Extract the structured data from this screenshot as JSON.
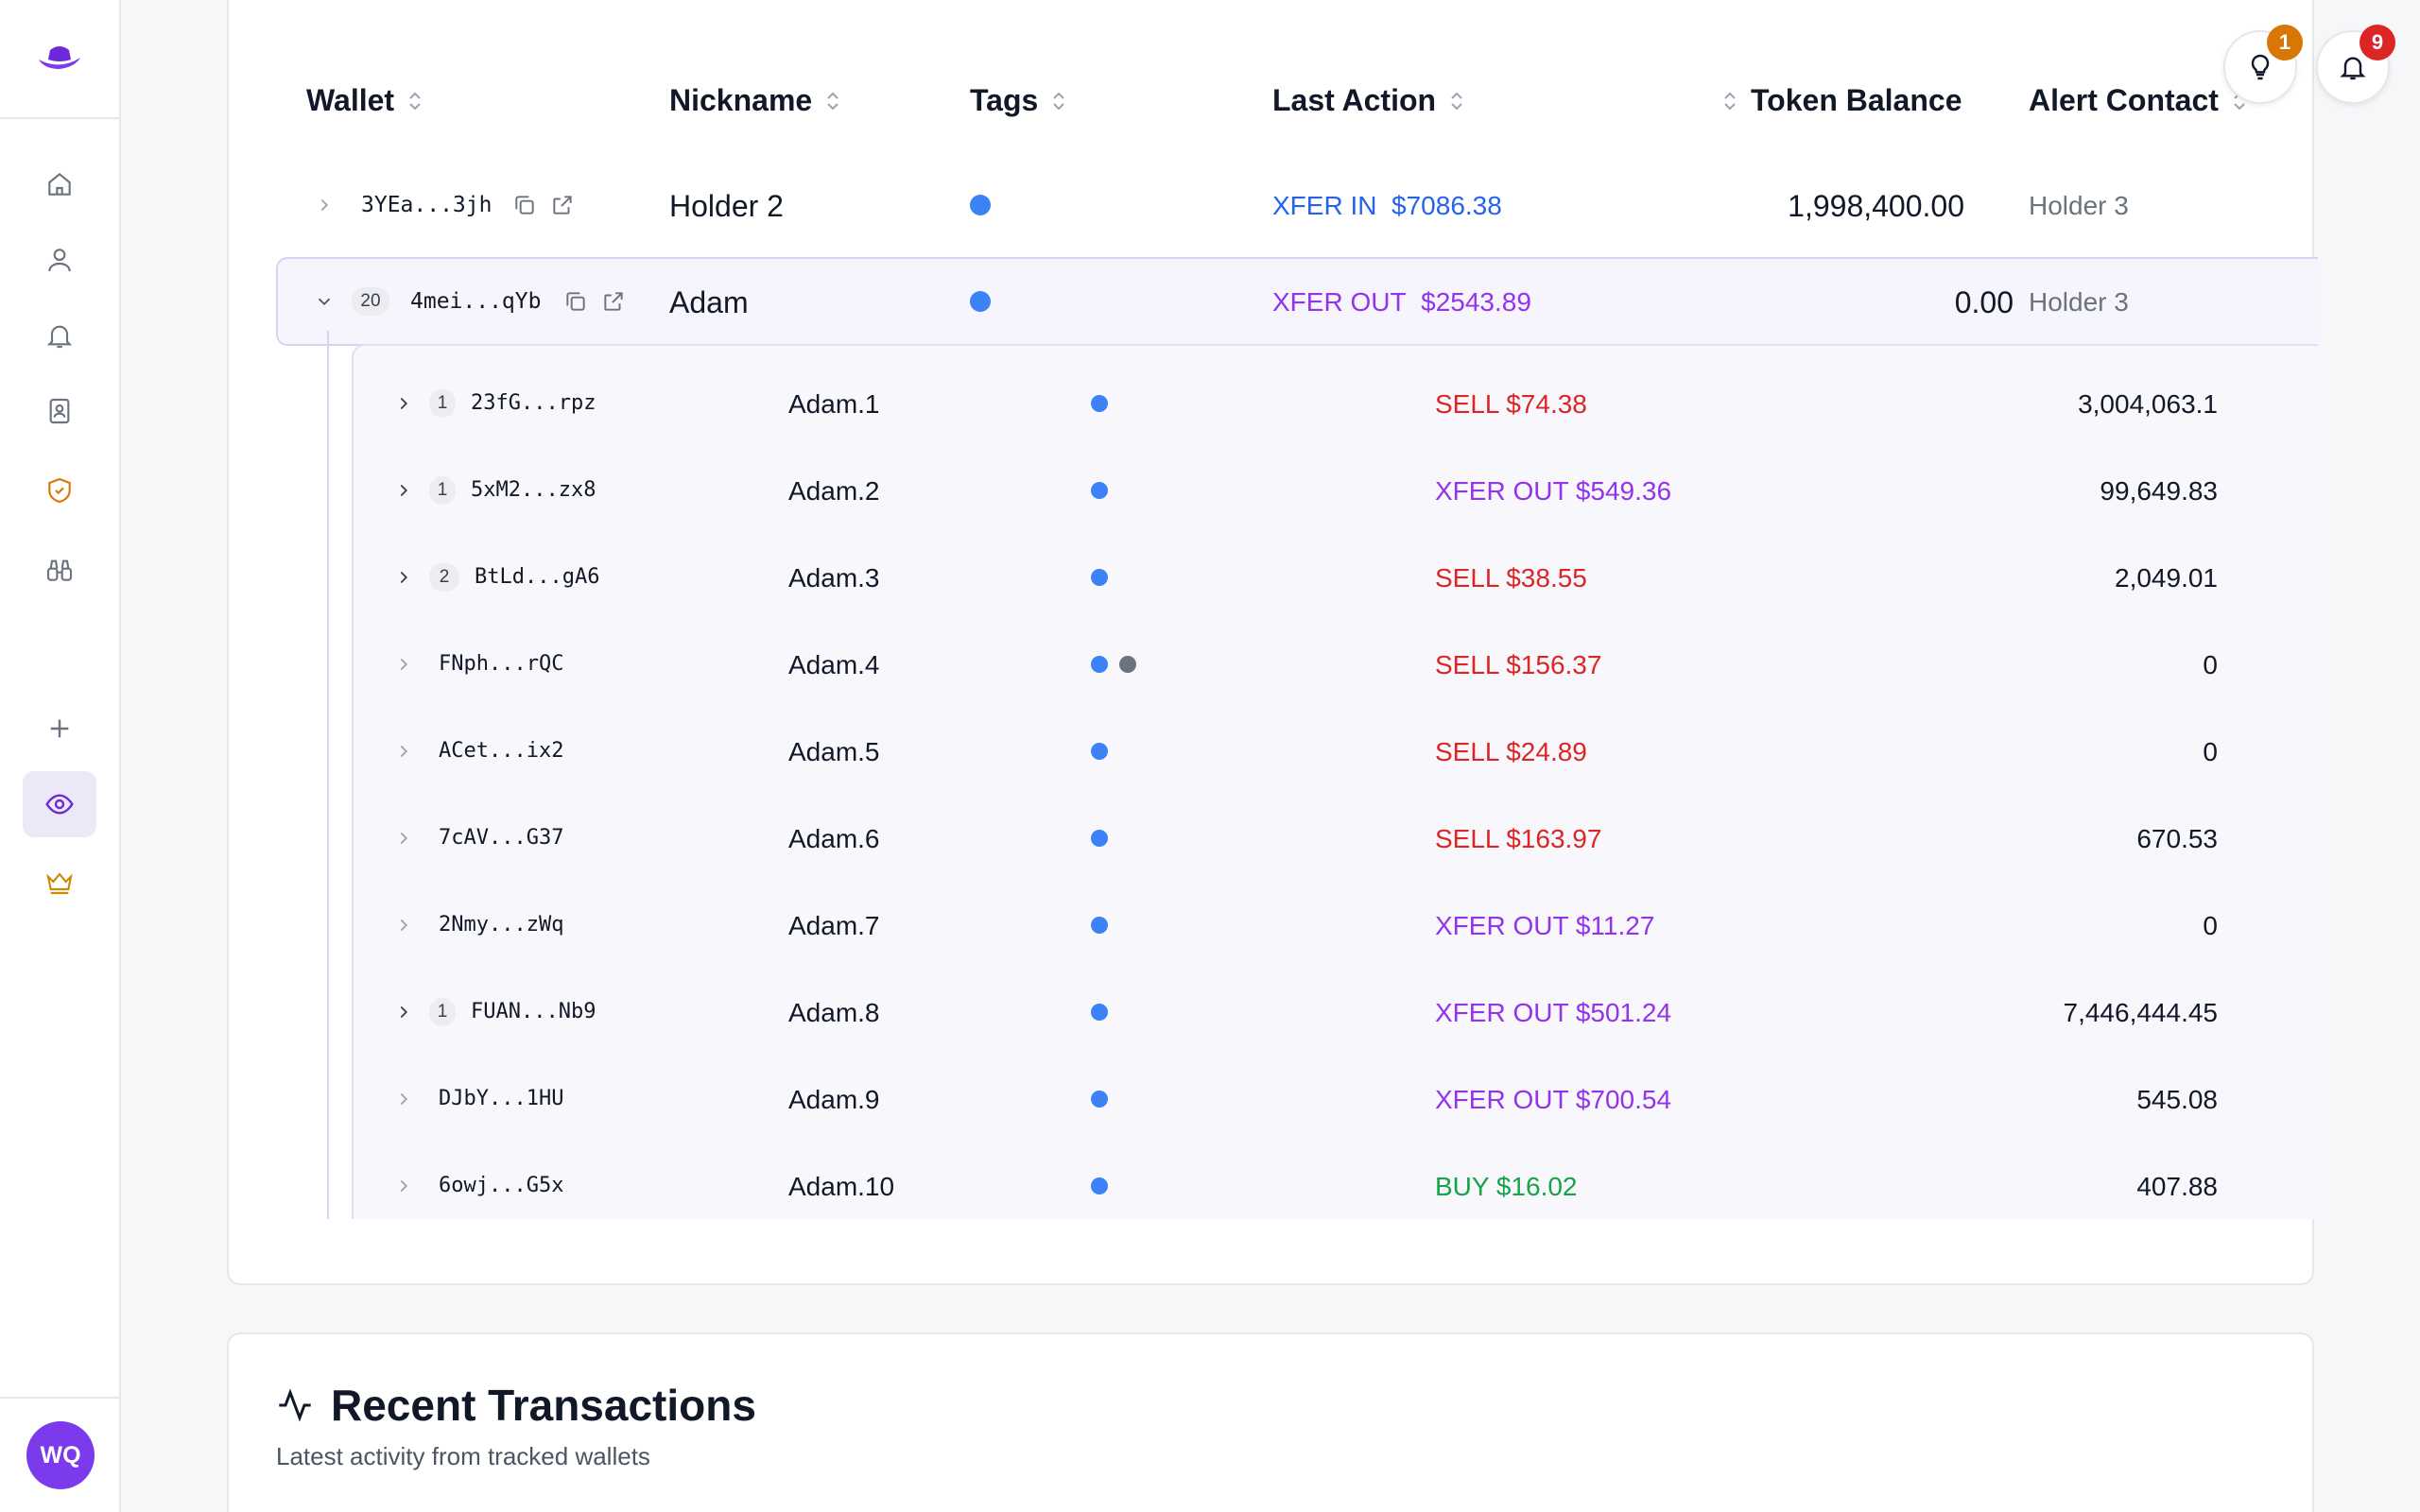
{
  "header_buttons": {
    "tips_badge": "1",
    "notifications_badge": "9",
    "tips_badge_color": "#d97706",
    "notifications_badge_color": "#dc2626"
  },
  "sidebar": {
    "items": [
      {
        "icon": "home-icon"
      },
      {
        "icon": "user-icon"
      },
      {
        "icon": "bell-icon"
      },
      {
        "icon": "contacts-icon"
      },
      {
        "icon": "shield-check-icon"
      },
      {
        "icon": "binoculars-icon"
      },
      {
        "icon": "plus-icon"
      },
      {
        "icon": "eye-icon",
        "active": true
      },
      {
        "icon": "crown-icon"
      }
    ],
    "user_initials": "WQ"
  },
  "table": {
    "columns": {
      "wallet": "Wallet",
      "nickname": "Nickname",
      "tags": "Tags",
      "last_action": "Last Action",
      "token_balance": "Token Balance",
      "alert_contact": "Alert Contact"
    },
    "rows": [
      {
        "wallet": "3YEa...3jh",
        "nickname": "Holder 2",
        "action_type": "XFER IN",
        "action_amount": "$7086.38",
        "balance": "1,998,400.00",
        "alert_contact": "Holder 3"
      },
      {
        "wallet": "4mei...qYb",
        "count": "20",
        "nickname": "Adam",
        "action_type": "XFER OUT",
        "action_amount": "$2543.89",
        "balance": "0.00",
        "alert_contact": "Holder 3",
        "expanded": true
      }
    ],
    "sub_rows": [
      {
        "wallet": "23fG...rpz",
        "count": "1",
        "nickname": "Adam.1",
        "action": "SELL $74.38",
        "kind": "sell",
        "balance": "3,004,063.1"
      },
      {
        "wallet": "5xM2...zx8",
        "count": "1",
        "nickname": "Adam.2",
        "action": "XFER OUT $549.36",
        "kind": "xfer-out",
        "balance": "99,649.83"
      },
      {
        "wallet": "BtLd...gA6",
        "count": "2",
        "nickname": "Adam.3",
        "action": "SELL $38.55",
        "kind": "sell",
        "balance": "2,049.01"
      },
      {
        "wallet": "FNph...rQC",
        "nickname": "Adam.4",
        "action": "SELL $156.37",
        "kind": "sell",
        "balance": "0",
        "extra_tag": true
      },
      {
        "wallet": "ACet...ix2",
        "nickname": "Adam.5",
        "action": "SELL $24.89",
        "kind": "sell",
        "balance": "0"
      },
      {
        "wallet": "7cAV...G37",
        "nickname": "Adam.6",
        "action": "SELL $163.97",
        "kind": "sell",
        "balance": "670.53"
      },
      {
        "wallet": "2Nmy...zWq",
        "nickname": "Adam.7",
        "action": "XFER OUT $11.27",
        "kind": "xfer-out",
        "balance": "0"
      },
      {
        "wallet": "FUAN...Nb9",
        "count": "1",
        "nickname": "Adam.8",
        "action": "XFER OUT $501.24",
        "kind": "xfer-out",
        "balance": "7,446,444.45"
      },
      {
        "wallet": "DJbY...1HU",
        "nickname": "Adam.9",
        "action": "XFER OUT $700.54",
        "kind": "xfer-out",
        "balance": "545.08"
      },
      {
        "wallet": "6owj...G5x",
        "nickname": "Adam.10",
        "action": "BUY $16.02",
        "kind": "buy",
        "balance": "407.88"
      }
    ]
  },
  "recent_transactions": {
    "title": "Recent Transactions",
    "subtitle": "Latest activity from tracked wallets"
  },
  "colors": {
    "accent": "#7c3aed",
    "tag_blue": "#3b82f6",
    "tag_gray": "#6b7280",
    "xfer_in": "#2563eb",
    "xfer_out": "#9333ea",
    "sell": "#dc2626",
    "buy": "#16a34a"
  }
}
